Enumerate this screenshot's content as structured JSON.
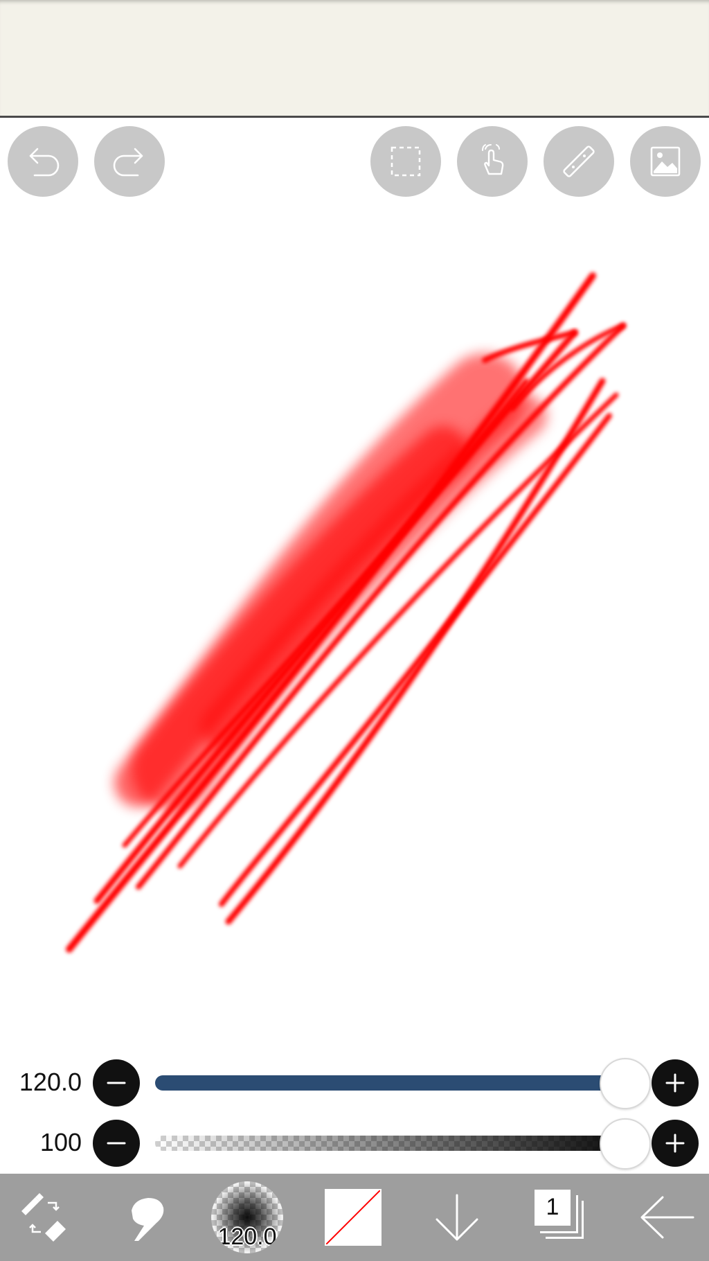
{
  "toolbar": {
    "buttons": [
      {
        "name": "undo",
        "icon": "undo-icon"
      },
      {
        "name": "redo",
        "icon": "redo-icon"
      },
      {
        "name": "selection",
        "icon": "selection-icon"
      },
      {
        "name": "transform",
        "icon": "hand-touch-icon"
      },
      {
        "name": "ruler",
        "icon": "ruler-icon"
      },
      {
        "name": "insert-image",
        "icon": "image-icon"
      }
    ]
  },
  "canvas": {
    "stroke_color": "#ff0000",
    "background": "#ffffff"
  },
  "sliders": {
    "size": {
      "label": "120.0",
      "value_fraction": 1.0,
      "track_color": "#2b4c73"
    },
    "opacity": {
      "label": "100",
      "value_fraction": 1.0
    }
  },
  "bottom_bar": {
    "tool_switch_icon": "pen-eraser-switch-icon",
    "smudge_icon": "finger-smudge-icon",
    "brush_size_label": "120.0",
    "color_swatch": {
      "fill": "#ffffff",
      "slash_color": "#ff0000"
    },
    "down_icon": "arrow-down-icon",
    "layer_count": "1",
    "back_icon": "arrow-left-icon"
  }
}
